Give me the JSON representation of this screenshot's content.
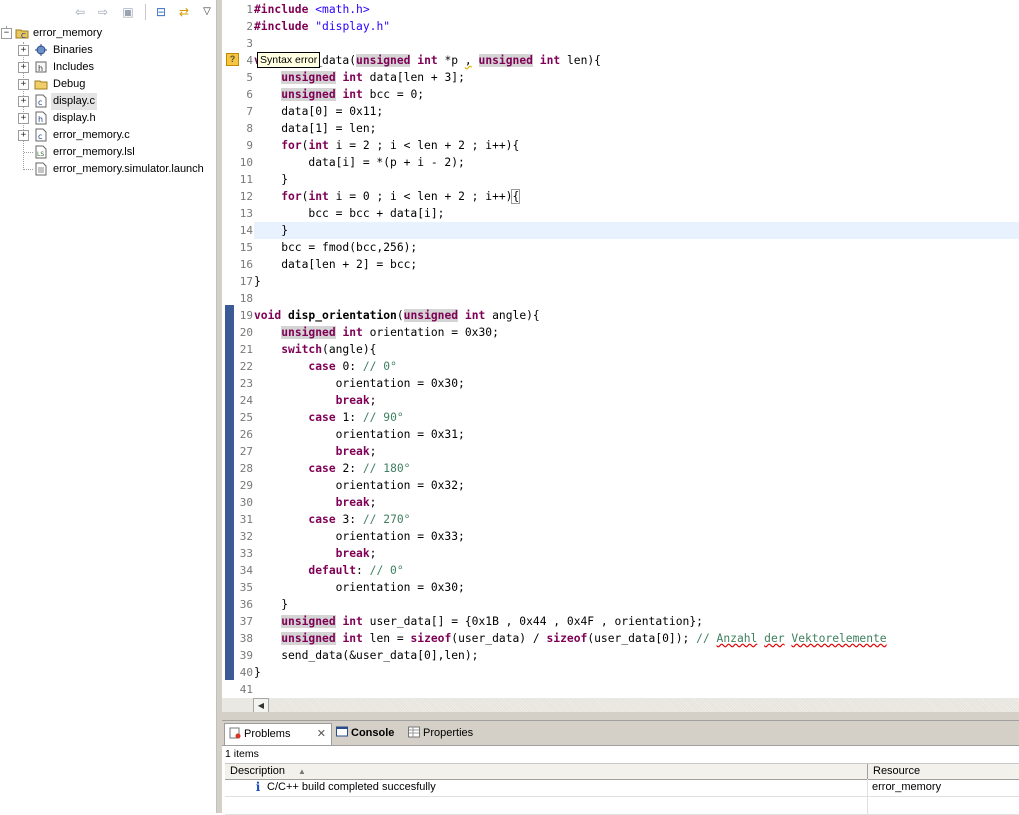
{
  "toolbar": {
    "icons": [
      "back-arrow-icon",
      "forward-arrow-icon",
      "up-folder-icon",
      "collapse-all-icon",
      "link-editor-icon",
      "view-menu-icon"
    ]
  },
  "explorer": {
    "project": "error_memory",
    "items": [
      {
        "label": "Binaries",
        "icon": "binaries-icon",
        "expandable": true
      },
      {
        "label": "Includes",
        "icon": "includes-icon",
        "expandable": true
      },
      {
        "label": "Debug",
        "icon": "folder-icon",
        "expandable": true
      },
      {
        "label": "display.c",
        "icon": "c-file-icon",
        "expandable": true,
        "selected": true
      },
      {
        "label": "display.h",
        "icon": "h-file-icon",
        "expandable": true
      },
      {
        "label": "error_memory.c",
        "icon": "c-file-icon",
        "expandable": true
      },
      {
        "label": "error_memory.lsl",
        "icon": "lsl-file-icon",
        "expandable": false
      },
      {
        "label": "error_memory.simulator.launch",
        "icon": "launch-file-icon",
        "expandable": false
      }
    ]
  },
  "editor": {
    "tooltip": "Syntax error",
    "current_line": 14,
    "lines": [
      "1",
      "2",
      "3",
      "4",
      "5",
      "6",
      "7",
      "8",
      "9",
      "10",
      "11",
      "12",
      "13",
      "14",
      "15",
      "16",
      "17",
      "18",
      "19",
      "20",
      "21",
      "22",
      "23",
      "24",
      "25",
      "26",
      "27",
      "28",
      "29",
      "30",
      "31",
      "32",
      "33",
      "34",
      "35",
      "36",
      "37",
      "38",
      "39",
      "40",
      "41"
    ]
  },
  "panel": {
    "tabs": [
      {
        "label": "Problems",
        "active": true
      },
      {
        "label": "Console",
        "active": false
      },
      {
        "label": "Properties",
        "active": false
      }
    ],
    "items_count": "1 items",
    "columns": [
      "Description",
      "Resource"
    ],
    "rows": [
      {
        "description": "C/C++ build completed succesfully",
        "resource": "error_memory"
      }
    ]
  }
}
